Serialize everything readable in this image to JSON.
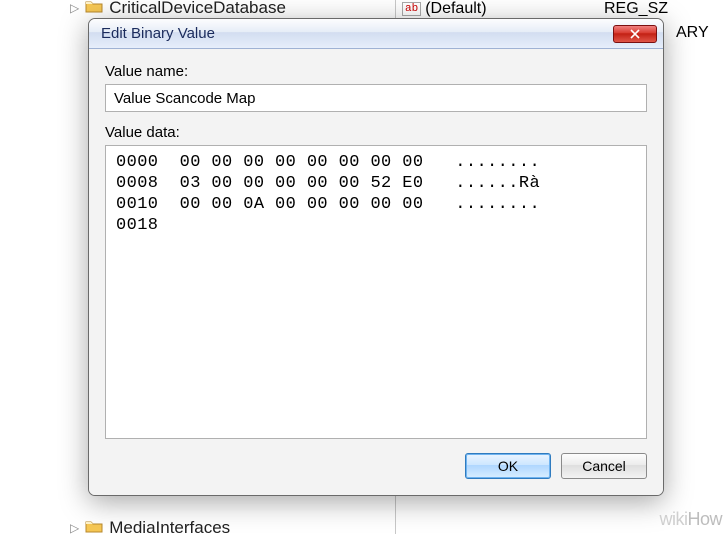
{
  "tree": {
    "top_item": "CriticalDeviceDatabase",
    "bottom_item": "MediaInterfaces"
  },
  "list": {
    "default_name": "(Default)",
    "default_type": "REG_SZ",
    "partial_type": "ARY"
  },
  "dialog": {
    "title": "Edit Binary Value",
    "value_name_label": "Value name:",
    "value_name": "Value Scancode Map",
    "value_data_label": "Value data:",
    "hex": "0000  00 00 00 00 00 00 00 00   ........\n0008  03 00 00 00 00 00 52 E0   ......Rà\n0010  00 00 0A 00 00 00 00 00   ........\n0018",
    "ok": "OK",
    "cancel": "Cancel"
  },
  "watermark": "wikiHow"
}
